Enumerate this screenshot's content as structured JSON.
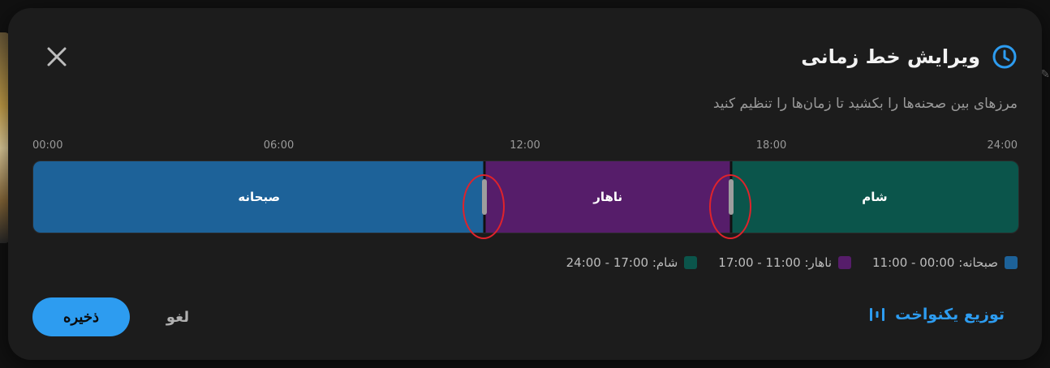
{
  "dialog": {
    "title": "ویرایش خط زمانی",
    "subtitle": "مرزهای بین صحنه‌ها را بکشید تا زمان‌ها را تنظیم کنید",
    "icons": {
      "close": "close-icon",
      "clock": "clock-icon",
      "distribute": "distribute-icon"
    }
  },
  "timeline": {
    "range_hours": [
      0,
      24
    ],
    "ticks": [
      "00:00",
      "06:00",
      "12:00",
      "18:00",
      "24:00"
    ],
    "segments": [
      {
        "label": "صبحانه",
        "start": 0,
        "end": 11,
        "color": "#1d6299"
      },
      {
        "label": "ناهار",
        "start": 11,
        "end": 17,
        "color": "#561d6a"
      },
      {
        "label": "شام",
        "start": 17,
        "end": 24,
        "color": "#0b554b"
      }
    ],
    "handles_at": [
      11,
      17
    ],
    "highlight_color": "#e0232b"
  },
  "legend": [
    {
      "text": "صبحانه: 00:00 - 11:00",
      "color": "#1d6299"
    },
    {
      "text": "ناهار: 11:00 - 17:00",
      "color": "#561d6a"
    },
    {
      "text": "شام: 17:00 - 24:00",
      "color": "#0b554b"
    }
  ],
  "actions": {
    "save_label": "ذخیره",
    "cancel_label": "لغو",
    "distribute_label": "توزیع یکنواخت",
    "accent": "#2d9cf0"
  }
}
